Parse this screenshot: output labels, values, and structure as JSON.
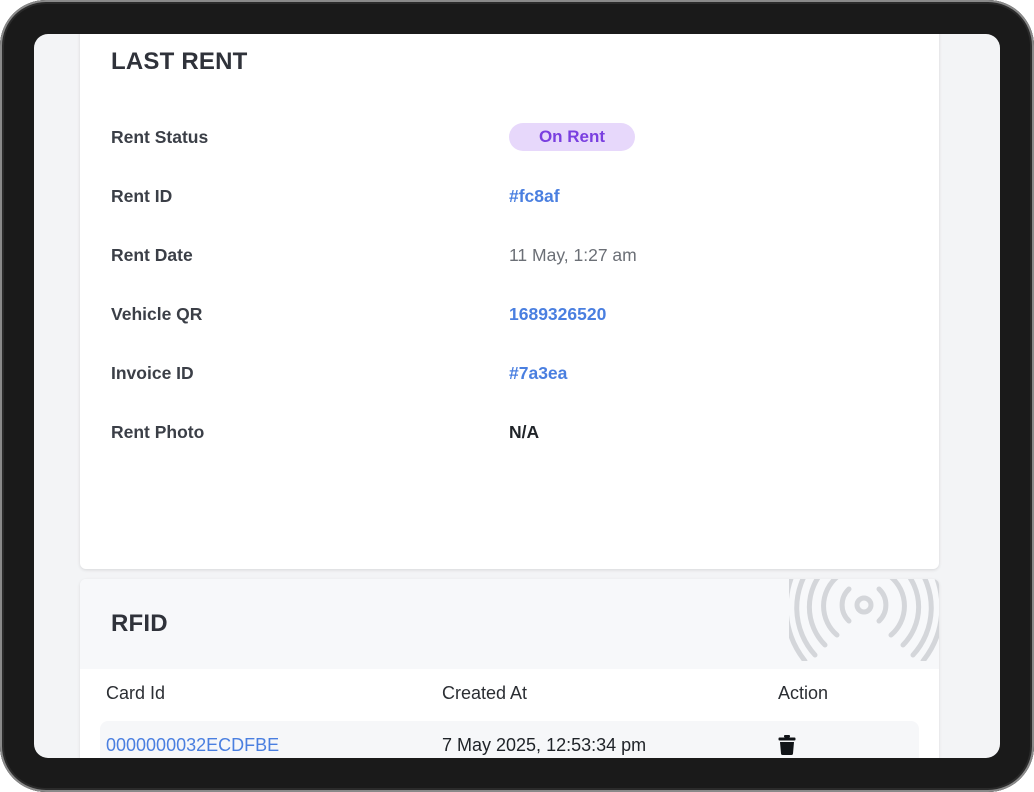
{
  "last_rent": {
    "title": "LAST RENT",
    "status_label": "Rent Status",
    "status_value": "On Rent",
    "rent_id_label": "Rent ID",
    "rent_id_value": "#fc8af",
    "rent_date_label": "Rent Date",
    "rent_date_value": "11 May, 1:27 am",
    "vehicle_qr_label": "Vehicle QR",
    "vehicle_qr_value": "1689326520",
    "invoice_id_label": "Invoice ID",
    "invoice_id_value": "#7a3ea",
    "rent_photo_label": "Rent Photo",
    "rent_photo_value": "N/A"
  },
  "rfid": {
    "title": "RFID",
    "header_icon": "rfid-signal-icon",
    "columns": [
      "Card Id",
      "Created At",
      "Action"
    ],
    "rows": [
      {
        "card_id": "0000000032ECDFBE",
        "created_at": "7 May 2025, 12:53:34 pm",
        "action_icon": "trash-icon"
      }
    ]
  },
  "colors": {
    "link": "#4a7fe0",
    "badge_bg": "#e7d8fb",
    "badge_text": "#7a3fe0"
  }
}
